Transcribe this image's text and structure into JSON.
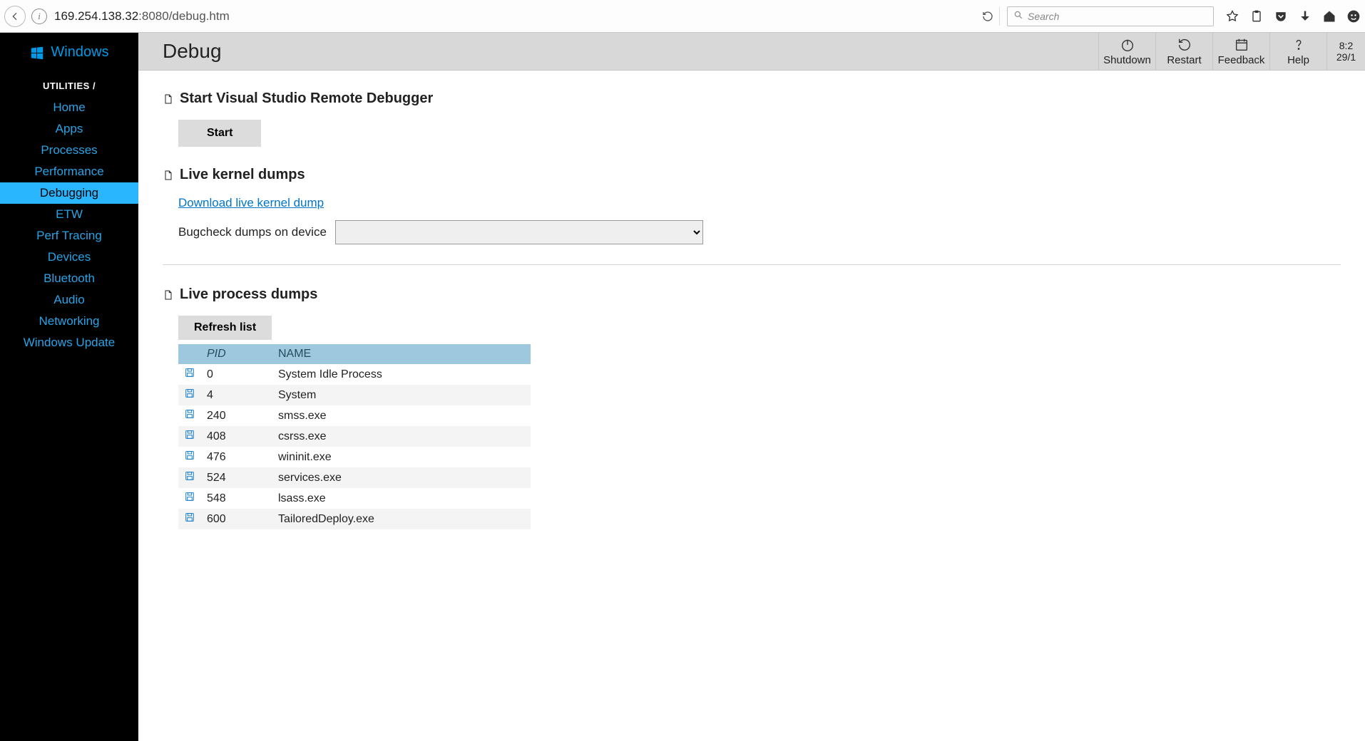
{
  "browser": {
    "url_prefix": "169.254.138.32",
    "url_suffix": ":8080/debug.htm",
    "search_placeholder": "Search"
  },
  "brand": "Windows",
  "sidebar": {
    "section": "UTILITIES /",
    "items": [
      "Home",
      "Apps",
      "Processes",
      "Performance",
      "Debugging",
      "ETW",
      "Perf Tracing",
      "Devices",
      "Bluetooth",
      "Audio",
      "Networking",
      "Windows Update"
    ],
    "active_index": 4
  },
  "titlebar": {
    "title": "Debug",
    "actions": [
      "Shutdown",
      "Restart",
      "Feedback",
      "Help"
    ],
    "time1": "8:2",
    "time2": "29/1"
  },
  "sections": {
    "vsdebug": {
      "heading": "Start Visual Studio Remote Debugger",
      "start": "Start"
    },
    "kernel": {
      "heading": "Live kernel dumps",
      "link": "Download live kernel dump",
      "label": "Bugcheck dumps on device"
    },
    "procs": {
      "heading": "Live process dumps",
      "refresh": "Refresh list",
      "cols": {
        "pid": "PID",
        "name": "NAME"
      },
      "rows": [
        {
          "pid": "0",
          "name": "System Idle Process"
        },
        {
          "pid": "4",
          "name": "System"
        },
        {
          "pid": "240",
          "name": "smss.exe"
        },
        {
          "pid": "408",
          "name": "csrss.exe"
        },
        {
          "pid": "476",
          "name": "wininit.exe"
        },
        {
          "pid": "524",
          "name": "services.exe"
        },
        {
          "pid": "548",
          "name": "lsass.exe"
        },
        {
          "pid": "600",
          "name": "TailoredDeploy.exe"
        }
      ]
    }
  }
}
